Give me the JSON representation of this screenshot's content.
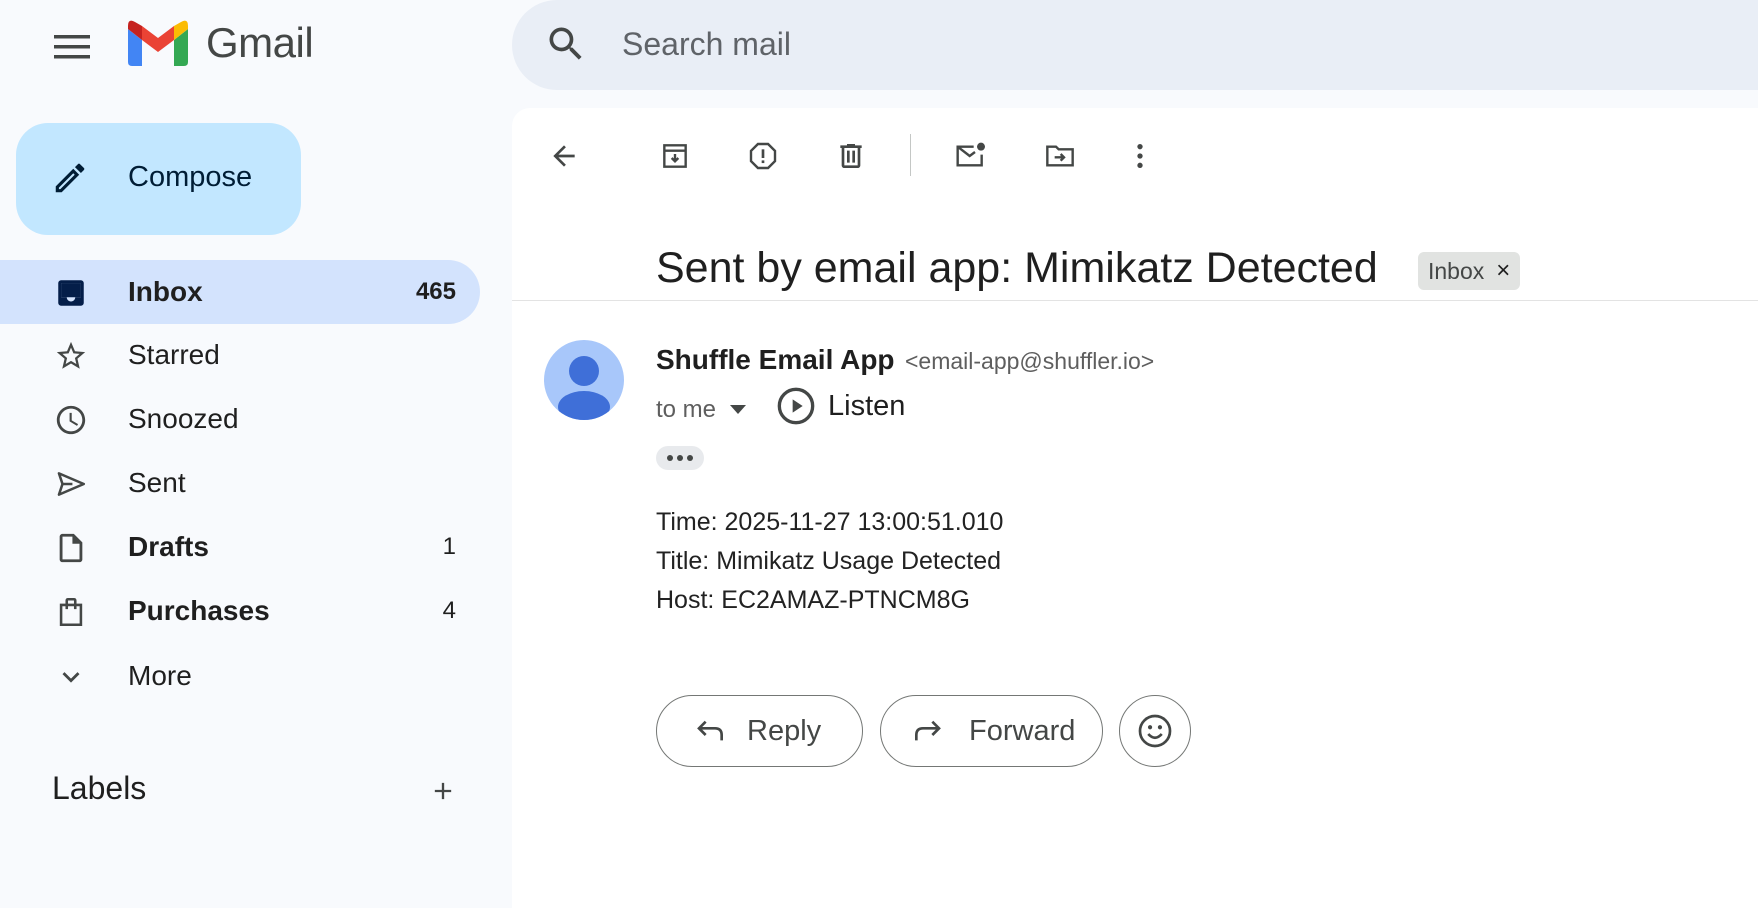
{
  "app": {
    "name": "Gmail"
  },
  "search": {
    "placeholder": "Search mail"
  },
  "compose": {
    "label": "Compose"
  },
  "nav": {
    "inbox": {
      "label": "Inbox",
      "count": "465"
    },
    "starred": {
      "label": "Starred"
    },
    "snoozed": {
      "label": "Snoozed"
    },
    "sent": {
      "label": "Sent"
    },
    "drafts": {
      "label": "Drafts",
      "count": "1"
    },
    "purchases": {
      "label": "Purchases",
      "count": "4"
    },
    "more": {
      "label": "More"
    }
  },
  "labels": {
    "heading": "Labels"
  },
  "email": {
    "subject": "Sent by email app: Mimikatz Detected",
    "label_chip": "Inbox",
    "label_chip_close": "×",
    "sender_name": "Shuffle Email App",
    "sender_email": "<email-app@shuffler.io>",
    "recipient": "to me",
    "listen_label": "Listen",
    "body": [
      "Time: 2025-11-27 13:00:51.010",
      "Title: Mimikatz Usage Detected",
      "Host: EC2AMAZ-PTNCM8G"
    ]
  },
  "actions": {
    "reply": "Reply",
    "forward": "Forward"
  },
  "colors": {
    "compose_bg": "#c2e7ff",
    "active_nav_bg": "#d3e3fd",
    "search_bg": "#e9eef6",
    "avatar_bg": "#a8c7fa",
    "avatar_fg": "#3f6fd8"
  }
}
